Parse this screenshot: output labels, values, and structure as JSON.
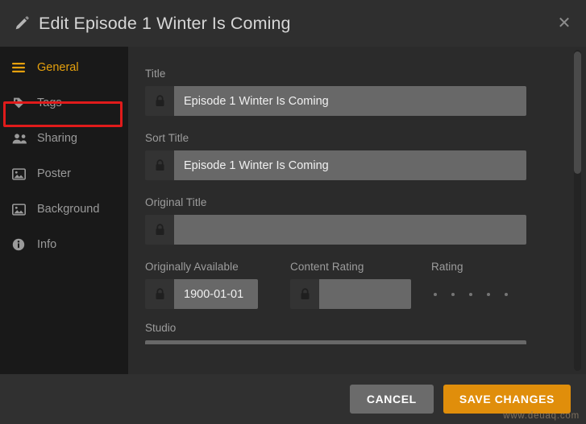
{
  "header": {
    "title": "Edit Episode 1 Winter Is Coming",
    "pencil_icon": "pencil-icon",
    "close_label": "✕"
  },
  "sidebar": {
    "items": [
      {
        "label": "General",
        "icon": "hamburger-icon",
        "active": true
      },
      {
        "label": "Tags",
        "icon": "tag-icon",
        "active": false
      },
      {
        "label": "Sharing",
        "icon": "users-icon",
        "active": false
      },
      {
        "label": "Poster",
        "icon": "image-icon",
        "active": false
      },
      {
        "label": "Background",
        "icon": "image-icon",
        "active": false
      },
      {
        "label": "Info",
        "icon": "info-icon",
        "active": false
      }
    ],
    "highlight_color": "#e01b1b",
    "active_color": "#e5a00d"
  },
  "form": {
    "title": {
      "label": "Title",
      "value": "Episode 1 Winter Is Coming",
      "placeholder": "",
      "lock_icon": "lock-icon"
    },
    "sort_title": {
      "label": "Sort Title",
      "value": "Episode 1 Winter Is Coming",
      "placeholder": "",
      "lock_icon": "lock-icon"
    },
    "original_title": {
      "label": "Original Title",
      "value": "",
      "placeholder": "",
      "lock_icon": "lock-icon"
    },
    "originally_available": {
      "label": "Originally Available",
      "value": "1900-01-01",
      "placeholder": "",
      "lock_icon": "lock-icon"
    },
    "content_rating": {
      "label": "Content Rating",
      "value": "",
      "placeholder": "",
      "lock_icon": "lock-icon"
    },
    "rating": {
      "label": "Rating",
      "dots": 5,
      "filled": 0
    },
    "studio": {
      "label": "Studio",
      "value": "",
      "placeholder": ""
    }
  },
  "footer": {
    "cancel_label": "CANCEL",
    "save_label": "SAVE CHANGES",
    "save_color": "#e08e0b"
  },
  "watermark": {
    "text": "www.deuaq.com"
  }
}
